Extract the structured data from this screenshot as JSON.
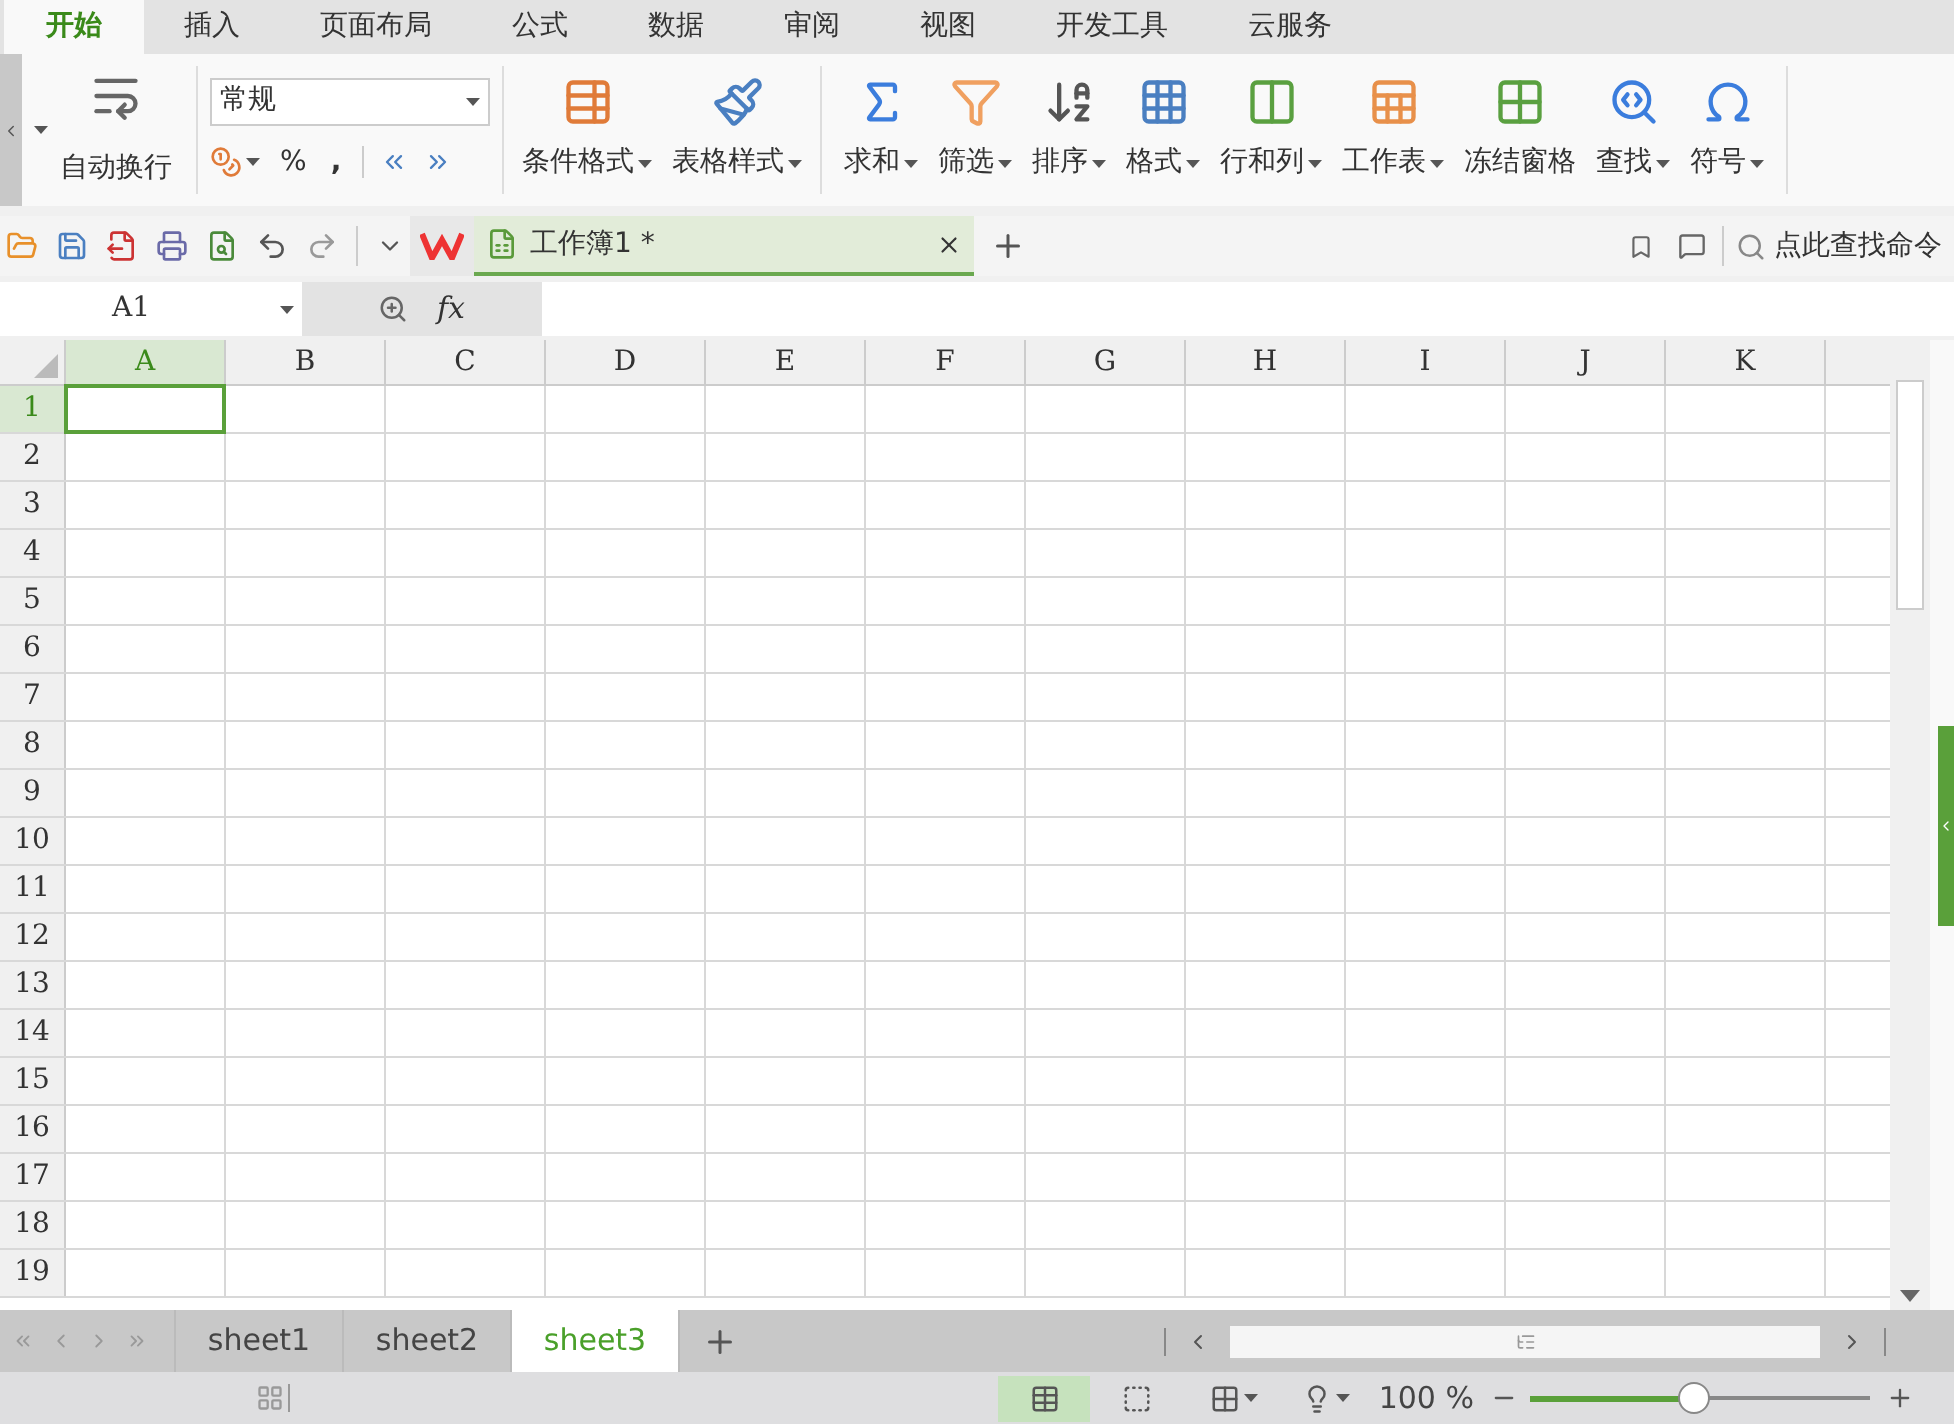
{
  "tabs": [
    {
      "label": "开始",
      "selected": true
    },
    {
      "label": "插入",
      "selected": false
    },
    {
      "label": "页面布局",
      "selected": false
    },
    {
      "label": "公式",
      "selected": false
    },
    {
      "label": "数据",
      "selected": false
    },
    {
      "label": "审阅",
      "selected": false
    },
    {
      "label": "视图",
      "selected": false
    },
    {
      "label": "开发工具",
      "selected": false
    },
    {
      "label": "云服务",
      "selected": false
    }
  ],
  "ribbon": {
    "wrap_button": "自动换行",
    "number_format": "常规",
    "percent": "%",
    "comma": ",",
    "style_group": [
      {
        "label": "条件格式",
        "dropdown": true
      },
      {
        "label": "表格样式",
        "dropdown": true
      }
    ],
    "edit_group": [
      {
        "label": "求和",
        "dropdown": true
      },
      {
        "label": "筛选",
        "dropdown": true
      },
      {
        "label": "排序",
        "dropdown": true
      },
      {
        "label": "格式",
        "dropdown": true
      },
      {
        "label": "行和列",
        "dropdown": true
      },
      {
        "label": "工作表",
        "dropdown": true
      },
      {
        "label": "冻结窗格",
        "dropdown": false
      },
      {
        "label": "查找",
        "dropdown": true
      },
      {
        "label": "符号",
        "dropdown": true
      }
    ]
  },
  "document_tab": {
    "title": "工作簿1 *"
  },
  "command_search": {
    "placeholder": "点此查找命令"
  },
  "formula_bar": {
    "name_box": "A1",
    "fx": "fx"
  },
  "columns": [
    {
      "label": "A",
      "selected": true
    },
    {
      "label": "B",
      "selected": false
    },
    {
      "label": "C",
      "selected": false
    },
    {
      "label": "D",
      "selected": false
    },
    {
      "label": "E",
      "selected": false
    },
    {
      "label": "F",
      "selected": false
    },
    {
      "label": "G",
      "selected": false
    },
    {
      "label": "H",
      "selected": false
    },
    {
      "label": "I",
      "selected": false
    },
    {
      "label": "J",
      "selected": false
    },
    {
      "label": "K",
      "selected": false
    }
  ],
  "rows": [
    {
      "label": "1",
      "selected": true
    },
    {
      "label": "2",
      "selected": false
    },
    {
      "label": "3",
      "selected": false
    },
    {
      "label": "4",
      "selected": false
    },
    {
      "label": "5",
      "selected": false
    },
    {
      "label": "6",
      "selected": false
    },
    {
      "label": "7",
      "selected": false
    },
    {
      "label": "8",
      "selected": false
    },
    {
      "label": "9",
      "selected": false
    },
    {
      "label": "10",
      "selected": false
    },
    {
      "label": "11",
      "selected": false
    },
    {
      "label": "12",
      "selected": false
    },
    {
      "label": "13",
      "selected": false
    },
    {
      "label": "14",
      "selected": false
    },
    {
      "label": "15",
      "selected": false
    },
    {
      "label": "16",
      "selected": false
    },
    {
      "label": "17",
      "selected": false
    },
    {
      "label": "18",
      "selected": false
    },
    {
      "label": "19",
      "selected": false
    }
  ],
  "sheets": [
    {
      "label": "sheet1",
      "selected": false
    },
    {
      "label": "sheet2",
      "selected": false
    },
    {
      "label": "sheet3",
      "selected": true
    }
  ],
  "status_bar": {
    "views": [
      {
        "selected": true
      },
      {
        "selected": false
      }
    ],
    "zoom": "100 %",
    "zoom_level": {
      "level": 0.48
    }
  }
}
